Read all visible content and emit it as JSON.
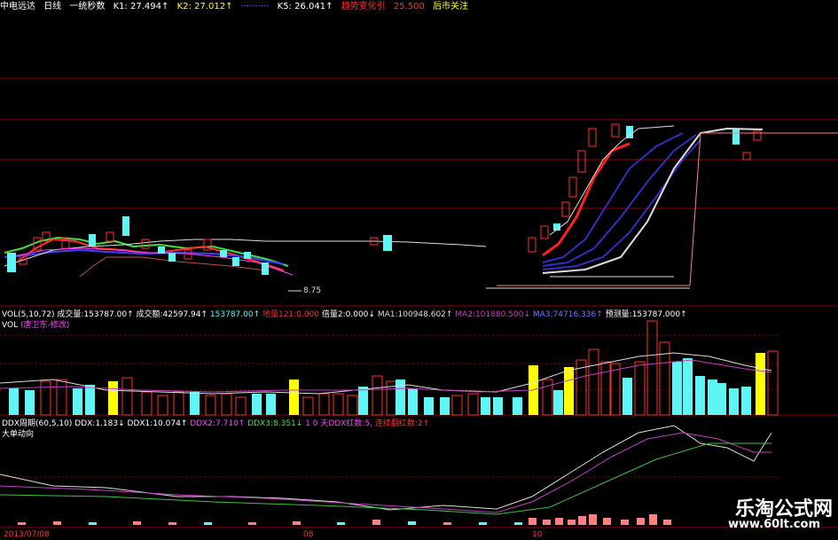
{
  "header": {
    "stock_name": "中电远达",
    "period": "日线",
    "indicator": "一统秒数",
    "k1_label": "K1: 27.494",
    "k1_arrow": "↑",
    "k2_label": "K2: 27.012",
    "k2_arrow": "↑",
    "k5_label": "K5: 26.041",
    "k5_arrow": "↑",
    "trend_label": "趋势变化引",
    "trend_value": "25.500",
    "tail_label": "后市关注"
  },
  "price_label": "8.75",
  "vol_panel": {
    "title": "VOL(5,10,72)",
    "items": [
      {
        "label": "成交量:",
        "value": "153787.00",
        "arrow": "↑"
      },
      {
        "label": "成交额:",
        "value": "42597.94",
        "arrow": "↑"
      },
      {
        "label": "",
        "value": "153787.00",
        "arrow": "↑"
      },
      {
        "label": "地量121:",
        "value": "0.000",
        "arrow": ""
      },
      {
        "label": "倍量2:",
        "value": "0.000",
        "arrow": "↓"
      },
      {
        "label": "MA1:",
        "value": "100948.602",
        "arrow": "↑"
      },
      {
        "label": "MA2:",
        "value": "101880.500",
        "arrow": "↓"
      },
      {
        "label": "MA3:",
        "value": "74716.336",
        "arrow": "↑"
      },
      {
        "label": "预测量:",
        "value": "153787.000",
        "arrow": "↑"
      }
    ],
    "sub_title": "VOL",
    "sub_note": "(唐卫东-修改)"
  },
  "ddx_panel": {
    "title": "DDX周期(60,5,10)",
    "items": [
      {
        "label": "DDX:",
        "value": "1.183",
        "arrow": "↓"
      },
      {
        "label": "DDX1:",
        "value": "10.074",
        "arrow": "↑"
      },
      {
        "label": "DDX2:",
        "value": "7.710",
        "arrow": "↑"
      },
      {
        "label": "DDX3:",
        "value": "8.351",
        "arrow": "↓"
      }
    ],
    "note1": "1 0 天DDX红数:",
    "note1_value": "5,",
    "note2": "连续翻红数:",
    "note2_value": "2",
    "note2_arrow": "↑",
    "sub_title": "大单动向"
  },
  "date_axis": [
    "2013/07/08",
    "08",
    "10"
  ],
  "watermark": {
    "line1": "乐淘公式网",
    "line2": "www.60lt.com"
  },
  "colors": {
    "up_red": "#ff3030",
    "down_cyan": "#5ff5f5",
    "yellow": "#ffff00",
    "grid": "#8b0000"
  }
}
